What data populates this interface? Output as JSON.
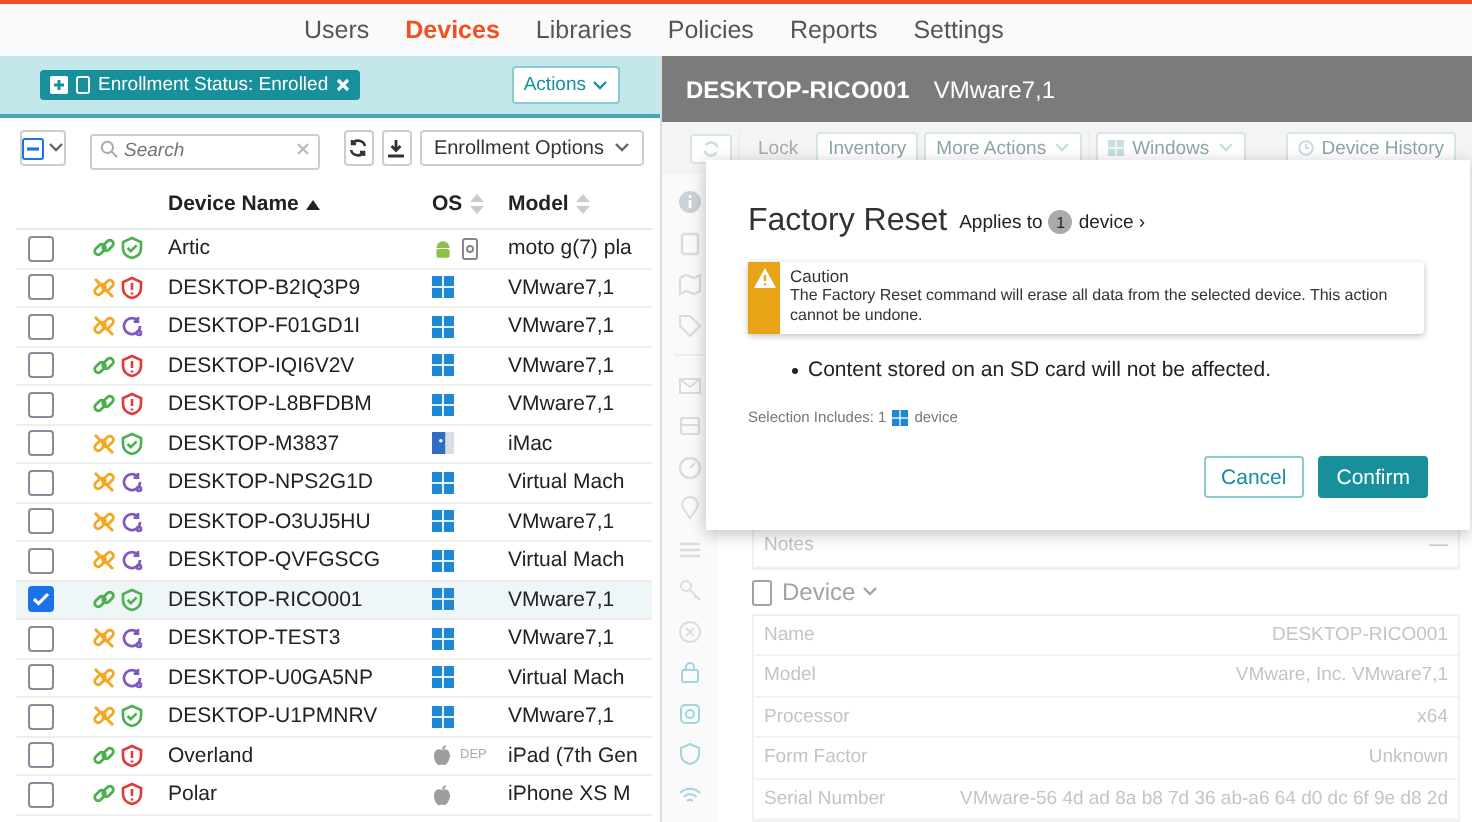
{
  "nav": {
    "items": [
      {
        "label": "Users",
        "selected": false
      },
      {
        "label": "Devices",
        "selected": true
      },
      {
        "label": "Libraries",
        "selected": false
      },
      {
        "label": "Policies",
        "selected": false
      },
      {
        "label": "Reports",
        "selected": false
      },
      {
        "label": "Settings",
        "selected": false
      }
    ]
  },
  "filter_bar": {
    "chip": "Enrollment Status: Enrolled",
    "actions": "Actions"
  },
  "list_toolbar": {
    "search_placeholder": "Search",
    "enrollment_options": "Enrollment Options"
  },
  "table": {
    "columns": [
      {
        "label": "Device Name",
        "sorted": true
      },
      {
        "label": "OS",
        "sorted": false
      },
      {
        "label": "Model",
        "sorted": false
      }
    ],
    "rows": [
      {
        "name": "Artic",
        "linked": true,
        "security": {
          "kind": "ok"
        },
        "os": {
          "kind": "android"
        },
        "work_profile": true,
        "os_tag": "",
        "model": "moto g(7) pla",
        "selected": false
      },
      {
        "name": "DESKTOP-B2IQ3P9",
        "linked": false,
        "security": {
          "kind": "alert"
        },
        "os": {
          "kind": "windows"
        },
        "work_profile": false,
        "os_tag": "",
        "model": "VMware7,1",
        "selected": false
      },
      {
        "name": "DESKTOP-F01GD1I",
        "linked": false,
        "security": {
          "kind": "pending"
        },
        "os": {
          "kind": "windows"
        },
        "work_profile": false,
        "os_tag": "",
        "model": "VMware7,1",
        "selected": false
      },
      {
        "name": "DESKTOP-IQI6V2V",
        "linked": true,
        "security": {
          "kind": "alert"
        },
        "os": {
          "kind": "windows"
        },
        "work_profile": false,
        "os_tag": "",
        "model": "VMware7,1",
        "selected": false
      },
      {
        "name": "DESKTOP-L8BFDBM",
        "linked": true,
        "security": {
          "kind": "alert"
        },
        "os": {
          "kind": "windows"
        },
        "work_profile": false,
        "os_tag": "",
        "model": "VMware7,1",
        "selected": false
      },
      {
        "name": "DESKTOP-M3837",
        "linked": false,
        "security": {
          "kind": "ok"
        },
        "os": {
          "kind": "mac"
        },
        "work_profile": false,
        "os_tag": "",
        "model": "iMac",
        "selected": false
      },
      {
        "name": "DESKTOP-NPS2G1D",
        "linked": false,
        "security": {
          "kind": "pending"
        },
        "os": {
          "kind": "windows"
        },
        "work_profile": false,
        "os_tag": "",
        "model": "Virtual Mach",
        "selected": false
      },
      {
        "name": "DESKTOP-O3UJ5HU",
        "linked": false,
        "security": {
          "kind": "pending"
        },
        "os": {
          "kind": "windows"
        },
        "work_profile": false,
        "os_tag": "",
        "model": "VMware7,1",
        "selected": false
      },
      {
        "name": "DESKTOP-QVFGSCG",
        "linked": false,
        "security": {
          "kind": "pending"
        },
        "os": {
          "kind": "windows"
        },
        "work_profile": false,
        "os_tag": "",
        "model": "Virtual Mach",
        "selected": false
      },
      {
        "name": "DESKTOP-RICO001",
        "linked": true,
        "security": {
          "kind": "ok"
        },
        "os": {
          "kind": "windows"
        },
        "work_profile": false,
        "os_tag": "",
        "model": "VMware7,1",
        "selected": true
      },
      {
        "name": "DESKTOP-TEST3",
        "linked": false,
        "security": {
          "kind": "pending"
        },
        "os": {
          "kind": "windows"
        },
        "work_profile": false,
        "os_tag": "",
        "model": "VMware7,1",
        "selected": false
      },
      {
        "name": "DESKTOP-U0GA5NP",
        "linked": false,
        "security": {
          "kind": "pending"
        },
        "os": {
          "kind": "windows"
        },
        "work_profile": false,
        "os_tag": "",
        "model": "Virtual Mach",
        "selected": false
      },
      {
        "name": "DESKTOP-U1PMNRV",
        "linked": false,
        "security": {
          "kind": "ok"
        },
        "os": {
          "kind": "windows"
        },
        "work_profile": false,
        "os_tag": "",
        "model": "VMware7,1",
        "selected": false
      },
      {
        "name": "Overland",
        "linked": true,
        "security": {
          "kind": "alert"
        },
        "os": {
          "kind": "apple"
        },
        "work_profile": false,
        "os_tag": "DEP",
        "model": "iPad (7th Gen",
        "selected": false
      },
      {
        "name": "Polar",
        "linked": true,
        "security": {
          "kind": "alert"
        },
        "os": {
          "kind": "apple"
        },
        "work_profile": false,
        "os_tag": "",
        "model": "iPhone XS M",
        "selected": false
      }
    ]
  },
  "detail": {
    "title": "DESKTOP-RICO001",
    "subtitle": "VMware7,1",
    "toolbar": [
      {
        "label": "Lock",
        "kind": "plain",
        "disabled": true
      },
      {
        "label": "Inventory",
        "kind": "plain",
        "disabled": false
      },
      {
        "label": "More Actions",
        "kind": "menu",
        "disabled": false
      },
      {
        "label": "Windows",
        "kind": "os-menu",
        "disabled": false
      }
    ],
    "history": "Device History",
    "notes": {
      "label": "Notes",
      "value": "—"
    },
    "section": "Device",
    "properties": [
      {
        "label": "Name",
        "value": "DESKTOP-RICO001"
      },
      {
        "label": "Model",
        "value": "VMware, Inc. VMware7,1"
      },
      {
        "label": "Processor",
        "value": "x64"
      },
      {
        "label": "Form Factor",
        "value": "Unknown"
      },
      {
        "label": "Serial Number",
        "value": "VMware-56 4d ad 8a b8 7d 36 ab-a6 64 d0 dc 6f 9e d8 2d"
      }
    ]
  },
  "modal": {
    "title": "Factory Reset",
    "applies_prefix": "Applies to",
    "count": "1",
    "applies_suffix": "device ›",
    "alert": {
      "title": "Caution",
      "message": "The Factory Reset command will erase all data from the selected device. This action cannot be undone."
    },
    "bullets": [
      "Content stored on an SD card will not be affected."
    ],
    "selection_prefix": "Selection Includes: 1",
    "selection_suffix": "device",
    "buttons": [
      {
        "label": "Cancel",
        "kind": "secondary"
      },
      {
        "label": "Confirm",
        "kind": "primary"
      }
    ]
  }
}
